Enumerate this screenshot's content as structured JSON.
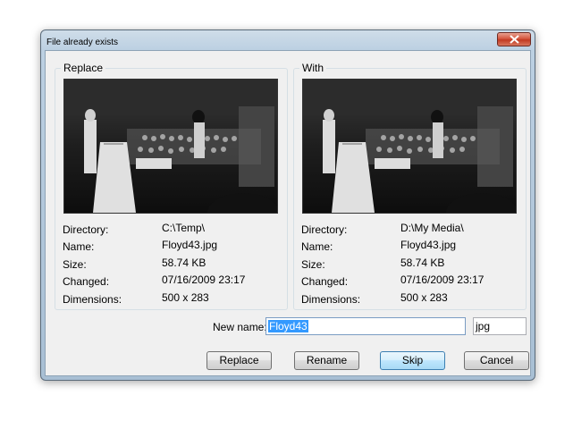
{
  "window": {
    "title": "File already exists"
  },
  "replace_group": {
    "label": "Replace",
    "directory": "C:\\Temp\\",
    "name": "Floyd43.jpg",
    "size": "58.74 KB",
    "changed": "07/16/2009 23:17",
    "dimensions": "500 x 283"
  },
  "with_group": {
    "label": "With",
    "directory": "D:\\My Media\\",
    "name": "Floyd43.jpg",
    "size": "58.74 KB",
    "changed": "07/16/2009 23:17",
    "dimensions": "500 x 283"
  },
  "field_labels": {
    "directory": "Directory:",
    "name": "Name:",
    "size": "Size:",
    "changed": "Changed:",
    "dimensions": "Dimensions:"
  },
  "new_name": {
    "label": "New name:",
    "value": "Floyd43",
    "extension": "jpg"
  },
  "buttons": {
    "replace": "Replace",
    "rename": "Rename",
    "skip": "Skip",
    "cancel": "Cancel"
  }
}
